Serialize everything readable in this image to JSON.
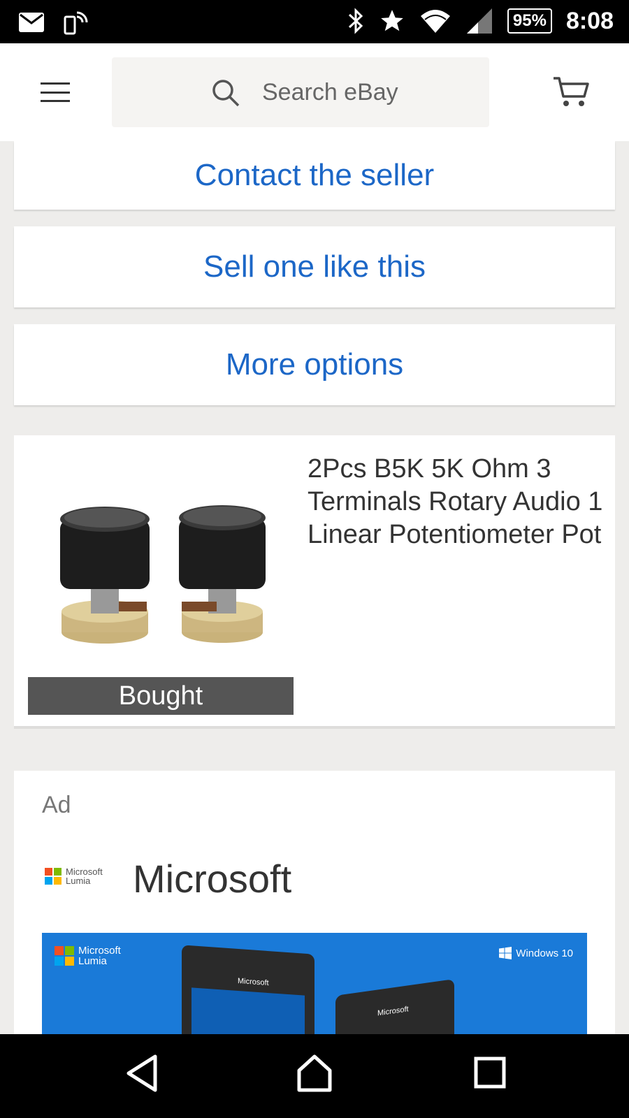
{
  "status_bar": {
    "battery": "95%",
    "time": "8:08",
    "icons": [
      "mail-icon",
      "screen-rotate-icon",
      "bluetooth-icon",
      "star-icon",
      "wifi-icon",
      "signal-icon",
      "battery-icon"
    ]
  },
  "header": {
    "search_placeholder": "Search eBay",
    "icons": [
      "menu-icon",
      "search-icon",
      "cart-icon"
    ]
  },
  "actions": {
    "contact": "Contact the seller",
    "sell": "Sell one like this",
    "more": "More options"
  },
  "item": {
    "title": "2Pcs B5K 5K Ohm 3 Terminals Rotary Audio 1 Linear Potentiometer Pot",
    "badge": "Bought"
  },
  "ad": {
    "label": "Ad",
    "brand": "Microsoft",
    "logo_line1": "Microsoft",
    "logo_line2": "Lumia",
    "banner_windows": "Windows 10",
    "phone_label": "Microsoft"
  },
  "colors": {
    "link_blue": "#1c67c7",
    "banner_blue": "#1a7ad8",
    "badge_gray": "#555555"
  }
}
